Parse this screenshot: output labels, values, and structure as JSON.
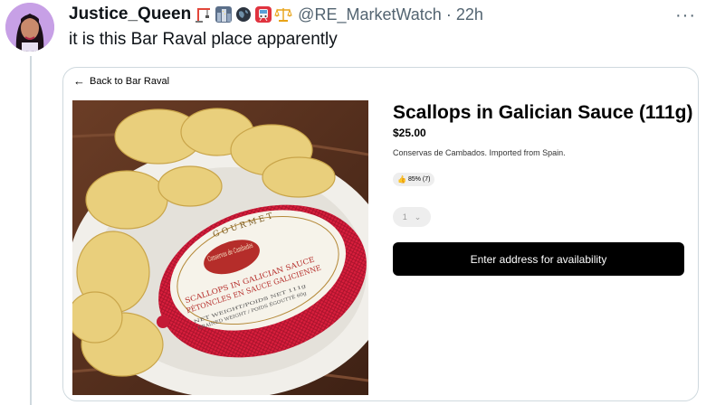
{
  "tweet": {
    "display_name": "Justice_Queen",
    "name_emojis": [
      "construction-crane-emoji",
      "cityscape-emoji",
      "globe-emoji",
      "metro-emoji",
      "balance-scale-emoji"
    ],
    "handle": "@RE_MarketWatch",
    "separator": "·",
    "time": "22h",
    "more_label": "···",
    "text": "it is this Bar Raval place apparently"
  },
  "card": {
    "back_link": "Back to Bar Raval",
    "product": {
      "title": "Scallops in Galician Sauce (111g)",
      "price": "$25.00",
      "description": "Conservas de Cambados. Imported from Spain.",
      "rating": "85% (7)",
      "quantity": "1",
      "cta": "Enter address for availability"
    },
    "image_label": {
      "brand_top": "GOURMET",
      "brand": "Conservas de Cambados",
      "line1": "SCALLOPS IN GALICIAN SAUCE",
      "line2": "PÉTONCLES EN SAUCE GALICIENNE",
      "line3": "NET WEIGHT/POIDS NET 111g",
      "line4": "DRAINED WEIGHT / POIDS ÉGOUTTÉ 60g"
    }
  },
  "colors": {
    "text_primary": "#0f1419",
    "text_secondary": "#536471",
    "border": "#cfd9de",
    "cta_bg": "#000000",
    "net_red": "#d81e3c"
  }
}
